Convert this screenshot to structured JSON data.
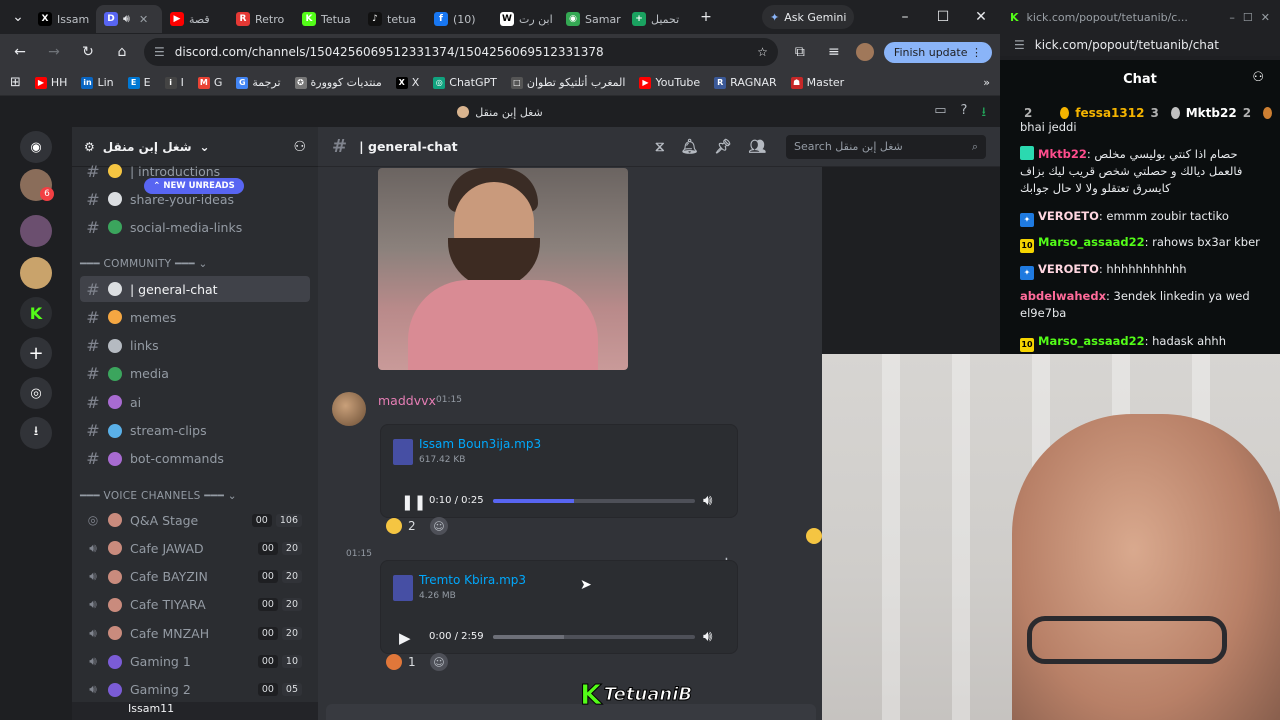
{
  "browser": {
    "tabs": [
      {
        "label": "Issam",
        "fav": "X",
        "color": "#000000",
        "active": false
      },
      {
        "label": "",
        "fav": "D",
        "color": "#5865f2",
        "active": true
      },
      {
        "label": "قصة",
        "fav": "▶",
        "color": "#ff0000",
        "active": false
      },
      {
        "label": "Retro",
        "fav": "R",
        "color": "#e53935",
        "active": false
      },
      {
        "label": "Tetua",
        "fav": "K",
        "color": "#53fc18",
        "active": false
      },
      {
        "label": "tetua",
        "fav": "♪",
        "color": "#111111",
        "active": false
      },
      {
        "label": "(10)",
        "fav": "f",
        "color": "#1877f2",
        "active": false
      },
      {
        "label": "ابن رت",
        "fav": "W",
        "color": "#ffffff",
        "active": false
      },
      {
        "label": "Samar",
        "fav": "◉",
        "color": "#34a853",
        "active": false
      },
      {
        "label": "تحميل",
        "fav": "+",
        "color": "#1aa260",
        "active": false
      }
    ],
    "gemini_label": "Ask Gemini",
    "url": "discord.com/channels/1504256069512331374/1504256069512331378",
    "finish_update_label": "Finish update",
    "bookmarks": [
      {
        "label": "HH",
        "fav": "▶",
        "color": "#ff0000"
      },
      {
        "label": "Lin",
        "fav": "in",
        "color": "#0a66c2"
      },
      {
        "label": "E",
        "fav": "E",
        "color": "#0078d4"
      },
      {
        "label": "I",
        "fav": "i",
        "color": "#444444"
      },
      {
        "label": "G",
        "fav": "M",
        "color": "#ea4335"
      },
      {
        "label": "ترجمة",
        "fav": "G",
        "color": "#4285f4"
      },
      {
        "label": "منتديات كووورة",
        "fav": "✪",
        "color": "#777777"
      },
      {
        "label": "X",
        "fav": "X",
        "color": "#000000"
      },
      {
        "label": "ChatGPT",
        "fav": "◎",
        "color": "#10a37f"
      },
      {
        "label": "المغرب أتلتيكو تطوان",
        "fav": "□",
        "color": "#555555"
      },
      {
        "label": "YouTube",
        "fav": "▶",
        "color": "#ff0000"
      },
      {
        "label": "RAGNAR",
        "fav": "R",
        "color": "#3b5998"
      },
      {
        "label": "Master",
        "fav": "☗",
        "color": "#c62828"
      }
    ]
  },
  "discord": {
    "server_name": "شغل إبن منقل",
    "topbar_title": "شغل إبن منقل",
    "new_unreads_label": "NEW UNREADS",
    "channels_top": [
      {
        "name": "| introductions",
        "emoji": "#f5c542"
      },
      {
        "name": "share-your-ideas",
        "emoji": "#dbdee1"
      },
      {
        "name": "social-media-links",
        "emoji": "#3ba55d"
      }
    ],
    "category_community": "COMMUNITY",
    "text_channels": [
      {
        "name": "| general-chat",
        "emoji": "#dbdee1",
        "selected": true
      },
      {
        "name": "memes",
        "emoji": "#f5a742",
        "selected": false
      },
      {
        "name": "links",
        "emoji": "#b5bac1",
        "selected": false
      },
      {
        "name": "media",
        "emoji": "#3ba55d",
        "selected": false
      },
      {
        "name": "ai",
        "emoji": "#a86bd1",
        "selected": false
      },
      {
        "name": "stream-clips",
        "emoji": "#5ab0e8",
        "selected": false
      },
      {
        "name": "bot-commands",
        "emoji": "#a86bd1",
        "selected": false
      }
    ],
    "category_voice": "VOICE CHANNELS",
    "voice_channels": [
      {
        "name": "Q&A Stage",
        "a": "00",
        "b": "106"
      },
      {
        "name": "Cafe JAWAD",
        "a": "00",
        "b": "20"
      },
      {
        "name": "Cafe BAYZIN",
        "a": "00",
        "b": "20"
      },
      {
        "name": "Cafe TIYARA",
        "a": "00",
        "b": "20"
      },
      {
        "name": "Cafe MNZAH",
        "a": "00",
        "b": "20"
      },
      {
        "name": "Gaming 1",
        "a": "00",
        "b": "10"
      },
      {
        "name": "Gaming 2",
        "a": "00",
        "b": "05"
      }
    ],
    "username": "Issam11",
    "guild_badge": "6",
    "channel_title": "| general-chat",
    "search_placeholder": "Search شغل إبن منقل",
    "messages": [
      {
        "author": "maddvvx",
        "time": "01:15",
        "file": {
          "name": "Issam Boun3ija.mp3",
          "size": "617.42 KB",
          "time": "0:10 / 0:25",
          "progress": 0.4,
          "playing": true
        },
        "reaction_count": "2"
      },
      {
        "time": "01:15",
        "file": {
          "name": "Tremto Kbira.mp3",
          "size": "4.26 MB",
          "time": "0:00 / 2:59",
          "progress": 0.0,
          "buffered": 0.35,
          "playing": false
        },
        "reaction_count": "1"
      }
    ]
  },
  "kick": {
    "url_title": "kick.com/popout/tetuanib/c...",
    "url": "kick.com/popout/tetuanib/chat",
    "header": "Chat",
    "leaderboard": [
      {
        "rank": "2",
        "name": "fessa1312",
        "count": "3"
      },
      {
        "rank": "",
        "name": "Mktb22",
        "count": "2"
      }
    ],
    "messages": [
      {
        "user": "",
        "color": "#ffffff",
        "badge": "",
        "text": "bhai jeddi"
      },
      {
        "user": "Mktb22",
        "color": "#ff4d8d",
        "badge": "gift",
        "text": "حصام اذا كنتي بوليسي مخلص فالعمل ديالك و حصلتي شخص قريب ليك بزاف كايسرق تعتقلو ولا لا حال جوابك"
      },
      {
        "user": "VEROETO",
        "color": "#ffd6e0",
        "badge": "verified",
        "text": "emmm zoubir tactiko"
      },
      {
        "user": "Marso_assaad22",
        "color": "#53fc18",
        "badge": "10",
        "text": "rahows bx3ar kber"
      },
      {
        "user": "VEROETO",
        "color": "#ffd6e0",
        "badge": "verified",
        "text": "hhhhhhhhhhh"
      },
      {
        "user": "abdelwahedx",
        "color": "#ff6b9a",
        "badge": "",
        "text": "3endek linkedin ya wed el9e7ba"
      },
      {
        "user": "Marso_assaad22",
        "color": "#53fc18",
        "badge": "10",
        "text": "hadask ahhh"
      }
    ]
  },
  "overlay_logo": "TetuaniB",
  "colors": {
    "kick_green": "#53fc18",
    "blurple": "#5865f2",
    "link": "#00a8fc",
    "mention": "#f23f43"
  }
}
